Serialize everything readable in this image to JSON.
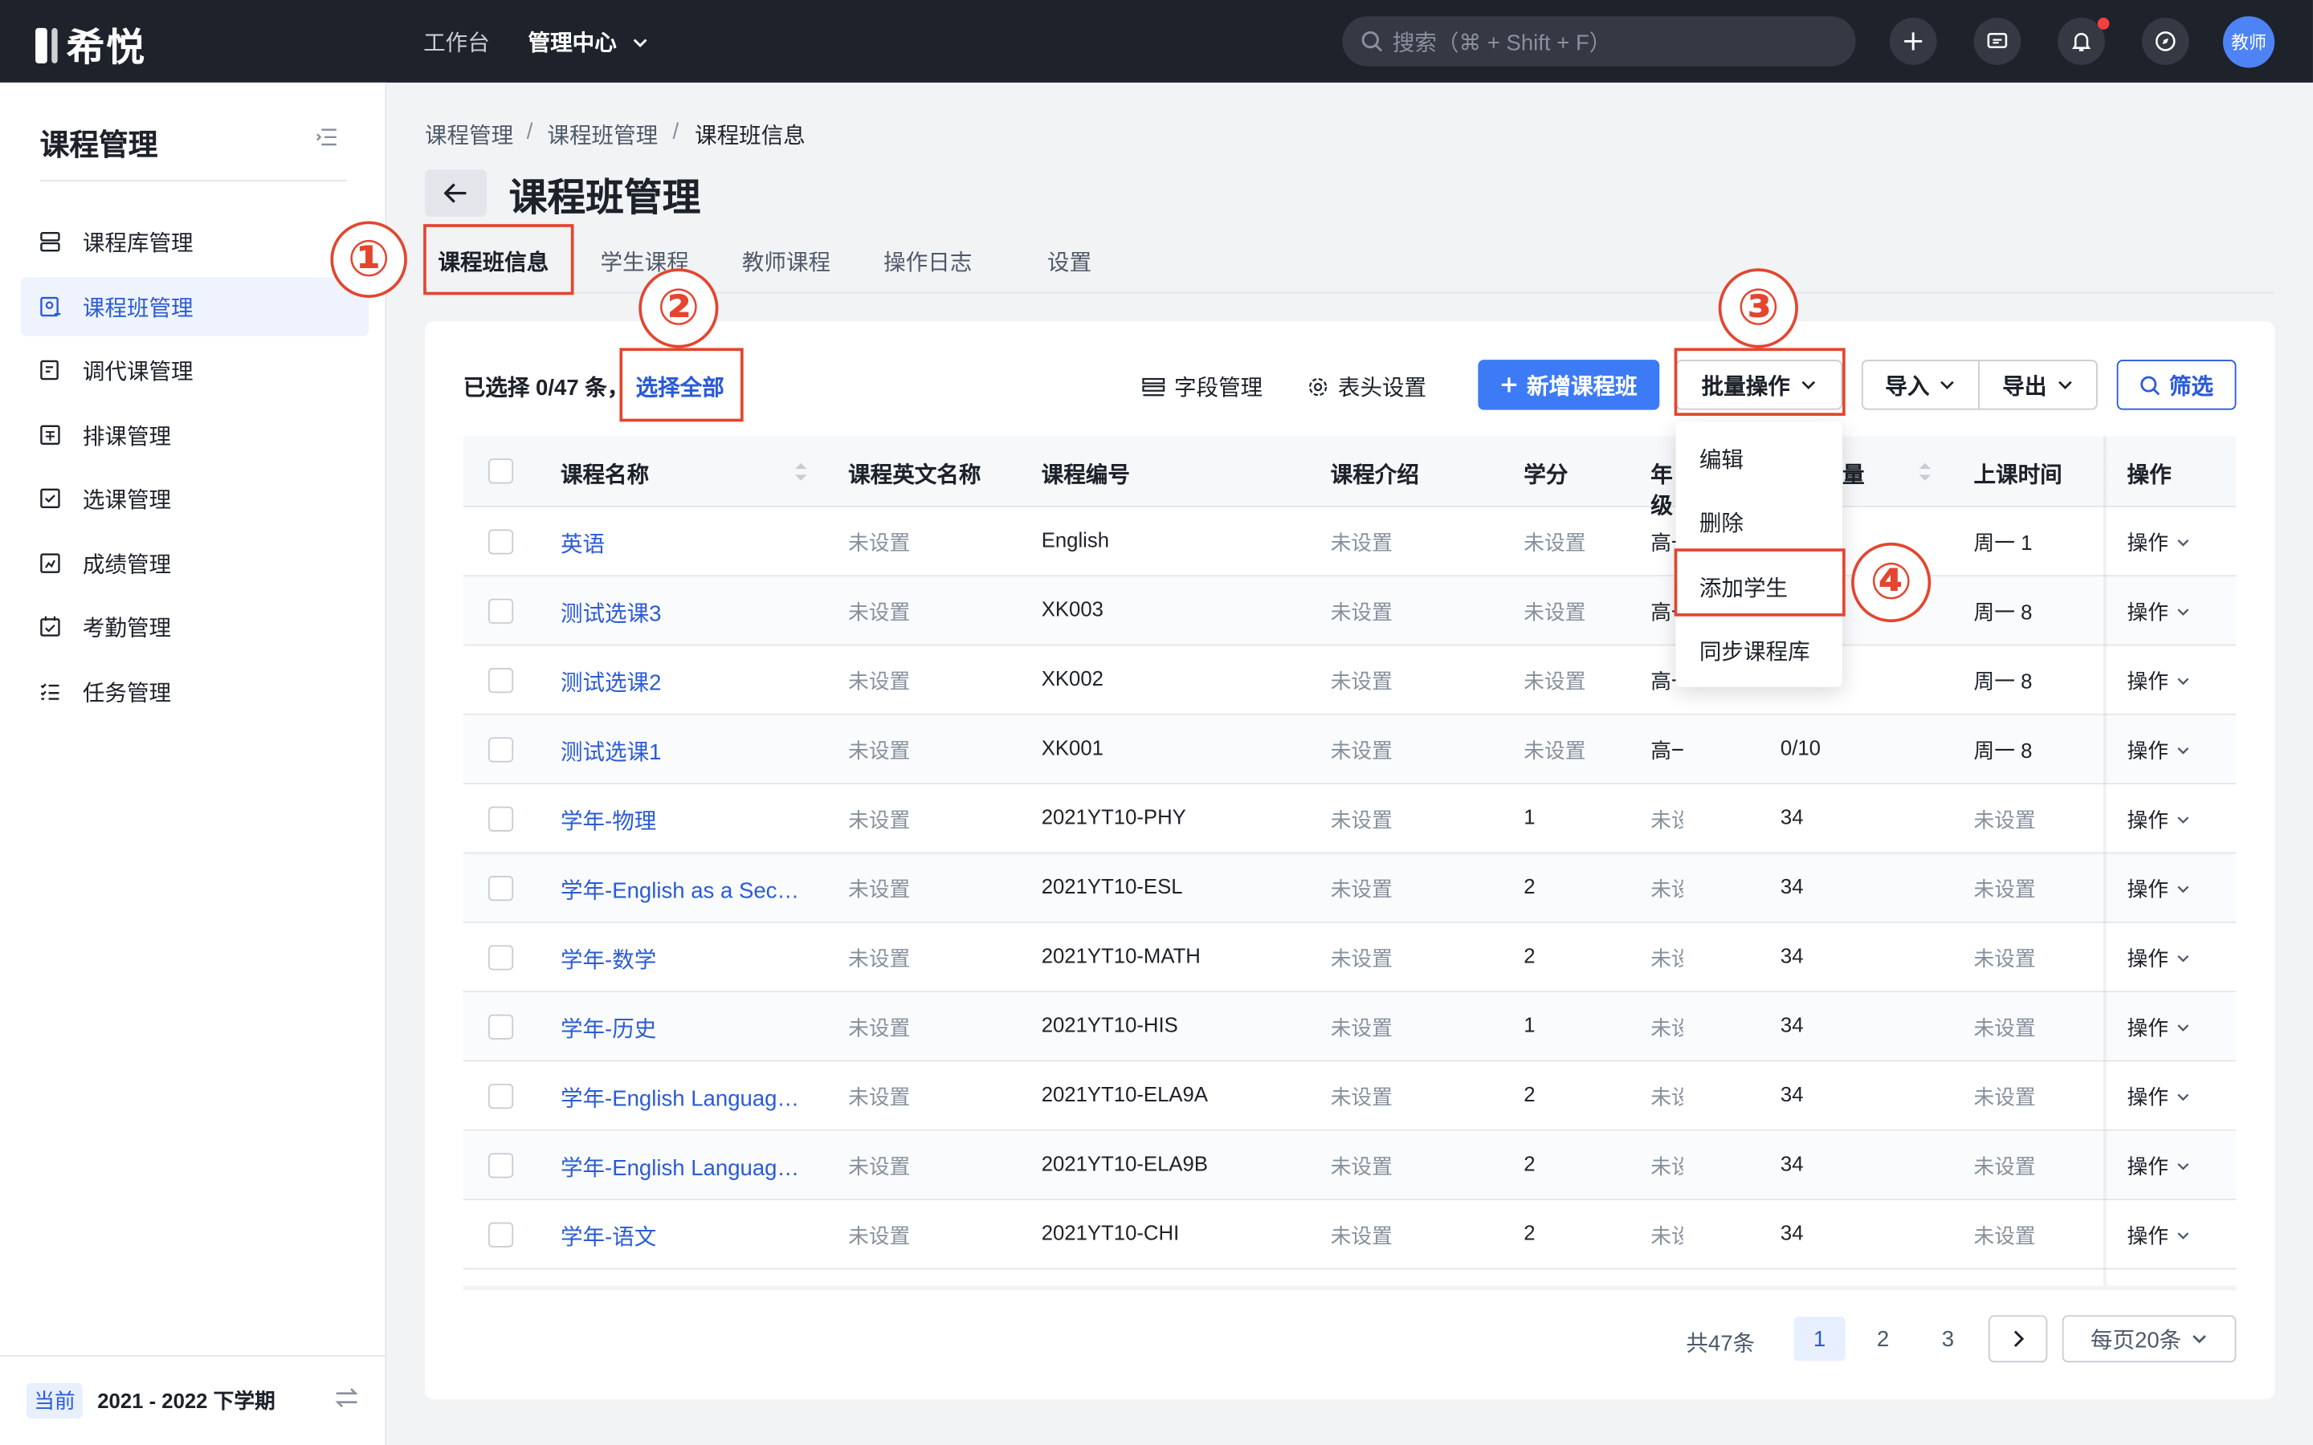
{
  "topbar": {
    "logo_text": "希悦",
    "nav": [
      "工作台",
      "管理中心"
    ],
    "search_placeholder": "搜索（⌘ + Shift + F）",
    "avatar_label": "教师"
  },
  "sidebar": {
    "title": "课程管理",
    "items": [
      "课程库管理",
      "课程班管理",
      "调代课管理",
      "排课管理",
      "选课管理",
      "成绩管理",
      "考勤管理",
      "任务管理"
    ],
    "active_index": 1,
    "term_badge": "当前",
    "term_text": "2021 - 2022 下学期"
  },
  "breadcrumb": [
    "课程管理",
    "课程班管理",
    "课程班信息"
  ],
  "page_title": "课程班管理",
  "tabs": [
    "课程班信息",
    "学生课程",
    "教师课程",
    "操作日志",
    "设置"
  ],
  "toolbar": {
    "selected_info": "已选择 0/47 条，",
    "select_all": "选择全部",
    "field_manage": "字段管理",
    "header_settings": "表头设置",
    "new_class": "新增课程班",
    "batch_ops": "批量操作",
    "import": "导入",
    "export": "导出",
    "filter": "筛选"
  },
  "table": {
    "headers": [
      "课程名称",
      "课程英文名称",
      "课程编号",
      "课程介绍",
      "学分",
      "年级",
      "数量",
      "上课时间",
      "操作"
    ],
    "op_label": "操作",
    "rows": [
      [
        "英语",
        "未设置",
        "English",
        "未设置",
        "未设置",
        "高一",
        "",
        "周一 1"
      ],
      [
        "测试选课3",
        "未设置",
        "XK003",
        "未设置",
        "未设置",
        "高一",
        "",
        "周一 8"
      ],
      [
        "测试选课2",
        "未设置",
        "XK002",
        "未设置",
        "未设置",
        "高一",
        "",
        "周一 8"
      ],
      [
        "测试选课1",
        "未设置",
        "XK001",
        "未设置",
        "未设置",
        "高一",
        "0/10",
        "周一 8"
      ],
      [
        "学年-物理",
        "未设置",
        "2021YT10-PHY",
        "未设置",
        "1",
        "未设置",
        "34",
        "未设置"
      ],
      [
        "学年-English as a Sec…",
        "未设置",
        "2021YT10-ESL",
        "未设置",
        "2",
        "未设置",
        "34",
        "未设置"
      ],
      [
        "学年-数学",
        "未设置",
        "2021YT10-MATH",
        "未设置",
        "2",
        "未设置",
        "34",
        "未设置"
      ],
      [
        "学年-历史",
        "未设置",
        "2021YT10-HIS",
        "未设置",
        "1",
        "未设置",
        "34",
        "未设置"
      ],
      [
        "学年-English Languag…",
        "未设置",
        "2021YT10-ELA9A",
        "未设置",
        "2",
        "未设置",
        "34",
        "未设置"
      ],
      [
        "学年-English Languag…",
        "未设置",
        "2021YT10-ELA9B",
        "未设置",
        "2",
        "未设置",
        "34",
        "未设置"
      ],
      [
        "学年-语文",
        "未设置",
        "2021YT10-CHI",
        "未设置",
        "2",
        "未设置",
        "34",
        "未设置"
      ]
    ]
  },
  "dropdown": [
    "编辑",
    "删除",
    "添加学生",
    "同步课程库"
  ],
  "pagination": {
    "total": "共47条",
    "pages": [
      "1",
      "2",
      "3"
    ],
    "current": "1",
    "page_size": "每页20条"
  },
  "annotations": [
    "①",
    "②",
    "③",
    "④"
  ],
  "colors": {
    "accent": "#3d7bf6",
    "link": "#2a5bd7",
    "annotation": "#e4452f",
    "topbar": "#1e222b"
  }
}
